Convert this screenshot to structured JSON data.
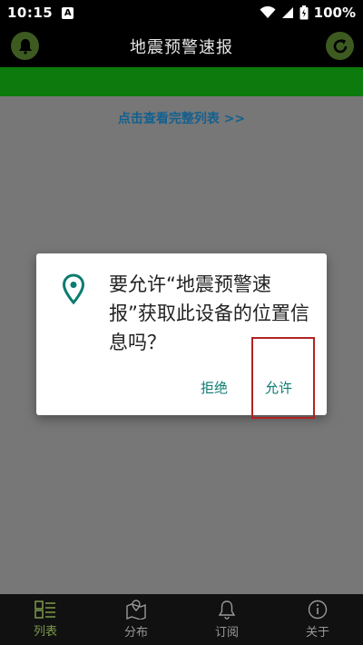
{
  "status_bar": {
    "time": "10:15",
    "battery": "100%",
    "icons": [
      "a-icon",
      "wifi-icon",
      "signal-icon",
      "battery-icon"
    ]
  },
  "app_bar": {
    "title": "地震预警速报",
    "left_icon": "bell-icon",
    "right_icon": "refresh-icon"
  },
  "main": {
    "view_all_link": "点击查看完整列表 >>"
  },
  "dialog": {
    "message": "要允许“地震预警速报”获取此设备的位置信息吗？",
    "icon": "location-pin-icon",
    "deny_label": "拒绝",
    "allow_label": "允许"
  },
  "bottom_nav": {
    "items": [
      {
        "label": "列表",
        "icon": "list-icon",
        "active": true
      },
      {
        "label": "分布",
        "icon": "map-icon",
        "active": false
      },
      {
        "label": "订阅",
        "icon": "bell-icon",
        "active": false
      },
      {
        "label": "关于",
        "icon": "info-icon",
        "active": false
      }
    ]
  },
  "colors": {
    "accent_green": "#0c7a0c",
    "dialog_button": "#0b7b70",
    "link": "#13608f",
    "highlight_box": "#b22222"
  }
}
